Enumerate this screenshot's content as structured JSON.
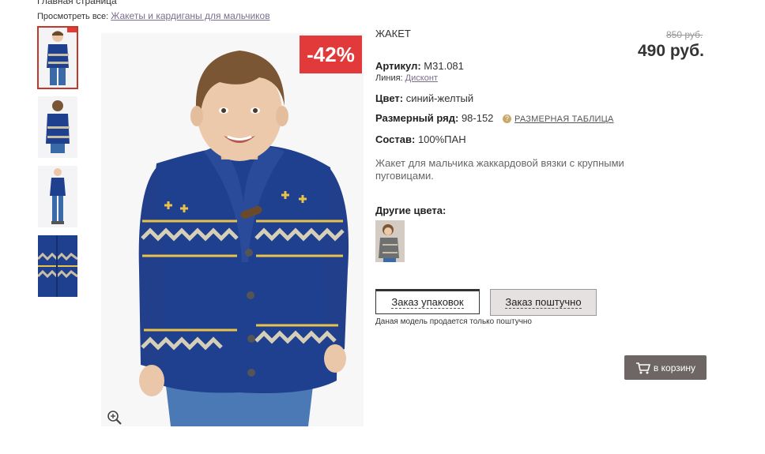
{
  "breadcrumb": {
    "home": "Главная страница"
  },
  "view_all": {
    "prefix": "Просмотреть все:",
    "link": "Жакеты и кардиганы для мальчиков"
  },
  "gallery": {
    "discount_badge": "-42%",
    "thumbnails": [
      "front",
      "back",
      "full-length",
      "detail"
    ]
  },
  "product": {
    "title": "ЖАКЕТ",
    "old_price": "850 руб.",
    "price": "490 руб.",
    "article_label": "Артикул:",
    "article_value": "М31.081",
    "line_label": "Линия:",
    "line_value": "Дисконт",
    "color_label": "Цвет:",
    "color_value": "синий-желтый",
    "size_label": "Размерный ряд:",
    "size_value": "98-152",
    "size_table_link": "РАЗМЕРНАЯ ТАБЛИЦА",
    "composition_label": "Состав:",
    "composition_value": "100%ПАН",
    "description": "Жакет для мальчика жаккардовой вязки с крупными пуговицами.",
    "other_colors_label": "Другие цвета:"
  },
  "order": {
    "pack_button": "Заказ упаковок",
    "single_button": "Заказ поштучно",
    "note": "Даная модель продается только поштучно",
    "cart_button": "в корзину"
  },
  "colors": {
    "discount": "#e23a3a",
    "cart": "#6e6664",
    "link": "#7a6f8c",
    "sweater": "#1f3f8f"
  }
}
